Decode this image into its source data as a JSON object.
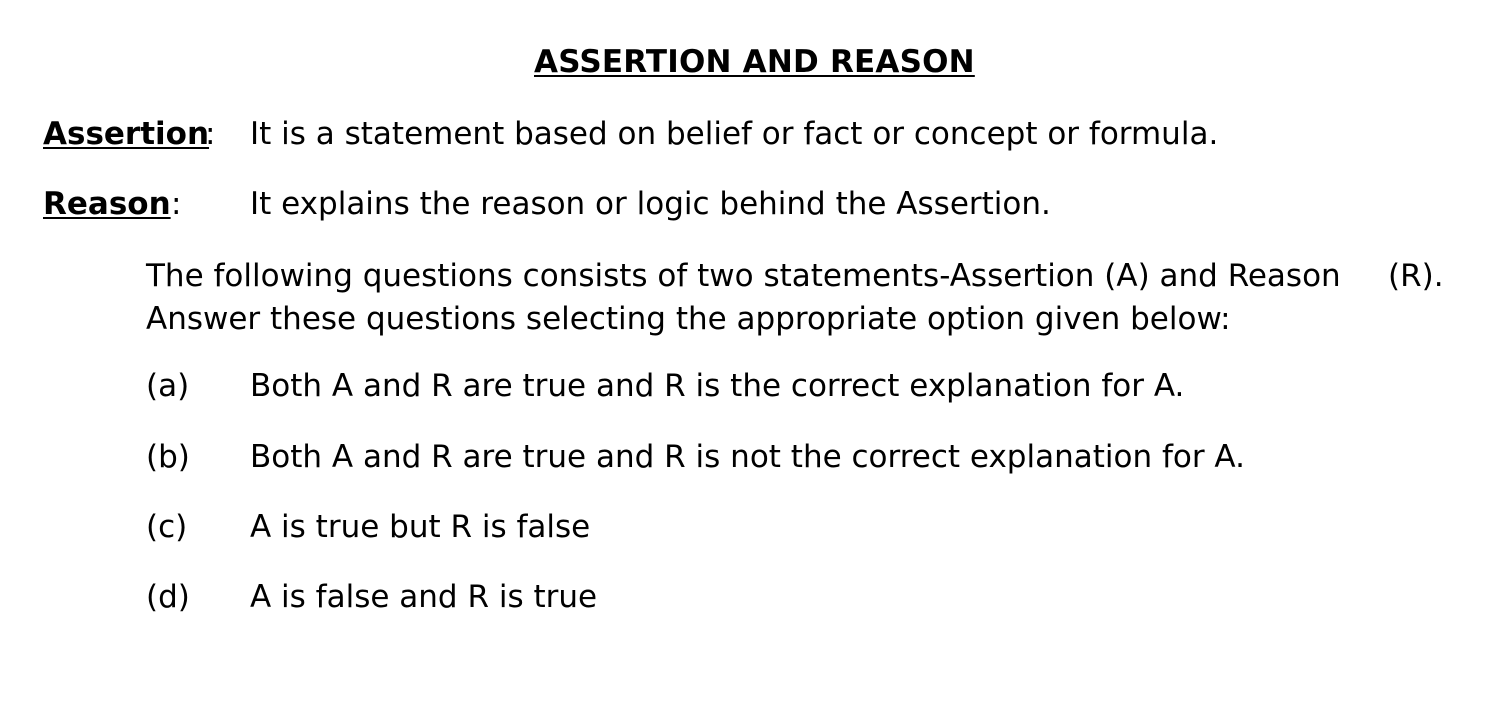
{
  "doc": {
    "title": "ASSERTION AND REASON",
    "definitions": [
      {
        "term": "Assertion",
        "colon": ":",
        "text": "It is a statement based on belief or fact or concept or formula."
      },
      {
        "term": "Reason",
        "colon": ":",
        "text": "It explains the reason or logic behind the Assertion."
      }
    ],
    "instructions": {
      "line1": "The following questions consists of two statements-Assertion (A) and Reason",
      "line1_end": "(R).",
      "line2": "Answer these questions selecting the appropriate option given below:"
    },
    "options": [
      {
        "letter": "(a)",
        "text": "Both A and R are true and R is the correct explanation for A."
      },
      {
        "letter": "(b)",
        "text": "Both A and R are true and R is not the correct explanation for A."
      },
      {
        "letter": "(c)",
        "text": "A is true but R is false"
      },
      {
        "letter": "(d)",
        "text": "A is false and R is true"
      }
    ]
  }
}
